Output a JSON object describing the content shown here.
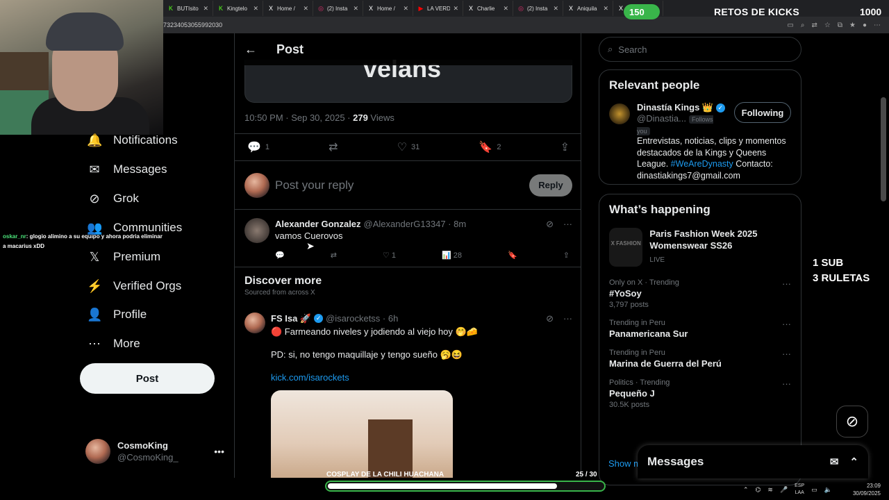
{
  "browser": {
    "tabs": [
      {
        "icon": "K",
        "label": "BUTIsito",
        "icon_color": "#53fc18"
      },
      {
        "icon": "K",
        "label": "Kingtelo",
        "icon_color": "#53fc18"
      },
      {
        "icon": "X",
        "label": "Home /",
        "icon_color": "#ffffff"
      },
      {
        "icon": "◎",
        "label": "(2) Insta",
        "icon_color": "#e1306c"
      },
      {
        "icon": "X",
        "label": "Home /",
        "icon_color": "#ffffff"
      },
      {
        "icon": "▶",
        "label": "LA VERD",
        "icon_color": "#ff0000"
      },
      {
        "icon": "X",
        "label": "Charlie",
        "icon_color": "#ffffff"
      },
      {
        "icon": "◎",
        "label": "(2) Insta",
        "icon_color": "#e1306c"
      },
      {
        "icon": "X",
        "label": "Aniquila",
        "icon_color": "#ffffff"
      },
      {
        "icon": "X",
        "label": "Hom",
        "icon_color": "#ffffff"
      }
    ],
    "url": "73234053055992030"
  },
  "overlays": {
    "goal_value": "150",
    "retos_title": "RETOS DE KICKS",
    "retos_count": "1000",
    "sub_line1": "1 SUB",
    "sub_line2": "3 RULETAS",
    "chat_user": "oskar_nr",
    "chat_message": ": glogio alimino a su equipo y ahora podria eliminar a macarius xDD",
    "progress_label": "COSPLAY DE LA CHILI HUACHANA",
    "progress_count": "25 / 30",
    "progress_value": 25,
    "progress_max": 30,
    "taskbar_lang_1": "ESP",
    "taskbar_lang_2": "LAA",
    "taskbar_time": "23:09",
    "taskbar_date": "30/09/2025"
  },
  "nav": {
    "items": [
      {
        "icon": "bell-icon",
        "glyph": "🔔",
        "label": "Notifications"
      },
      {
        "icon": "mail-icon",
        "glyph": "✉",
        "label": "Messages"
      },
      {
        "icon": "grok-icon",
        "glyph": "⊘",
        "label": "Grok"
      },
      {
        "icon": "communities-icon",
        "glyph": "👥",
        "label": "Communities"
      },
      {
        "icon": "x-logo-icon",
        "glyph": "𝕏",
        "label": "Premium"
      },
      {
        "icon": "lightning-icon",
        "glyph": "⚡",
        "label": "Verified Orgs"
      },
      {
        "icon": "person-icon",
        "glyph": "👤",
        "label": "Profile"
      },
      {
        "icon": "more-circle-icon",
        "glyph": "⋯",
        "label": "More"
      }
    ],
    "post_button": "Post",
    "account_name": "CosmoKing",
    "account_handle": "@CosmoKing_"
  },
  "main": {
    "header_title": "Post",
    "media_text": "velans",
    "meta_time": "10:50 PM · Sep 30, 2025 · ",
    "meta_views_count": "279",
    "meta_views_label": " Views",
    "actions": {
      "replies": "1",
      "reposts": "",
      "likes": "31",
      "bookmarks": "2"
    },
    "reply_placeholder": "Post your reply",
    "reply_button": "Reply",
    "reply_tweet": {
      "name": "Alexander Gonzalez",
      "handle": "@AlexanderG13347 · 8m",
      "text": "vamos Cuerovos",
      "likes": "1",
      "views": "28"
    },
    "discover_title": "Discover more",
    "discover_sub": "Sourced from across X",
    "discover_tweet": {
      "name": "FS Isa 🚀",
      "handle": "@isarocketss · 6h",
      "line1": "🔴 Farmeando niveles y jodiendo al viejo hoy 🤭🧀",
      "line2": "PD: si, no tengo maquillaje y tengo sueño 🥱😆",
      "link": "kick.com/isarockets"
    }
  },
  "right": {
    "search_placeholder": "Search",
    "relevant_title": "Relevant people",
    "person_name": "Dinastía Kings 👑",
    "person_handle": "@Dinastia...",
    "follows_you": "Follows you",
    "following_button": "Following",
    "bio_text": "Entrevistas, noticias, clips y momentos destacados de la Kings y Queens League. ",
    "bio_hashtag": "#WeAreDynasty",
    "bio_contact": " Contacto: dinastiakings7@gmail.com",
    "happening_title": "What’s happening",
    "featured": {
      "thumb": "X FASHION",
      "title": "Paris Fashion Week 2025 Womenswear SS26",
      "status": "LIVE"
    },
    "trends": [
      {
        "context": "Only on X · Trending",
        "name": "#YoSoy",
        "count": "3,797 posts"
      },
      {
        "context": "Trending in Peru",
        "name": "Panamericana Sur",
        "count": ""
      },
      {
        "context": "Trending in Peru",
        "name": "Marina de Guerra del Perú",
        "count": ""
      },
      {
        "context": "Politics · Trending",
        "name": "Pequeño J",
        "count": "30.5K posts"
      }
    ],
    "show_more": "Show m",
    "messages_title": "Messages"
  },
  "colors": {
    "accent": "#1d9bf0",
    "kick_green": "#39b54a",
    "background": "#000000"
  }
}
